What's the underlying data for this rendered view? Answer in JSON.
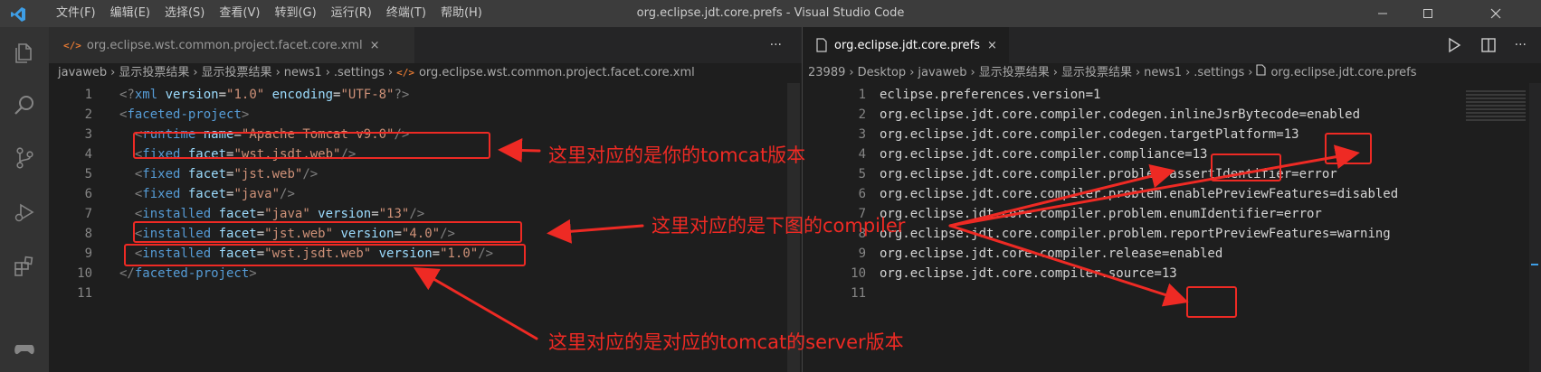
{
  "window": {
    "title": "org.eclipse.jdt.core.prefs - Visual Studio Code"
  },
  "menu": [
    "文件(F)",
    "编辑(E)",
    "选择(S)",
    "查看(V)",
    "转到(G)",
    "运行(R)",
    "终端(T)",
    "帮助(H)"
  ],
  "left_editor": {
    "tab_label": "org.eclipse.wst.common.project.facet.core.xml",
    "tab_icon": "xml-file-icon",
    "more_actions": "···",
    "breadcrumb": [
      "javaweb",
      "显示投票结果",
      "显示投票结果",
      "news1",
      ".settings",
      "org.eclipse.wst.common.project.facet.core.xml"
    ],
    "lines": [
      {
        "n": "1",
        "tokens": [
          {
            "t": "<?",
            "c": "punc"
          },
          {
            "t": "xml",
            "c": "tag"
          },
          {
            "t": " version",
            "c": "attr"
          },
          {
            "t": "=",
            "c": "plain"
          },
          {
            "t": "\"1.0\"",
            "c": "str"
          },
          {
            "t": " encoding",
            "c": "attr"
          },
          {
            "t": "=",
            "c": "plain"
          },
          {
            "t": "\"UTF-8\"",
            "c": "str"
          },
          {
            "t": "?>",
            "c": "punc"
          }
        ]
      },
      {
        "n": "2",
        "tokens": [
          {
            "t": "<",
            "c": "punc"
          },
          {
            "t": "faceted-project",
            "c": "tag"
          },
          {
            "t": ">",
            "c": "punc"
          }
        ]
      },
      {
        "n": "3",
        "tokens": [
          {
            "t": "  <",
            "c": "punc"
          },
          {
            "t": "runtime",
            "c": "tag"
          },
          {
            "t": " name",
            "c": "attr"
          },
          {
            "t": "=",
            "c": "plain"
          },
          {
            "t": "\"Apache Tomcat v9.0\"",
            "c": "str"
          },
          {
            "t": "/>",
            "c": "punc"
          }
        ]
      },
      {
        "n": "4",
        "tokens": [
          {
            "t": "  <",
            "c": "punc"
          },
          {
            "t": "fixed",
            "c": "tag"
          },
          {
            "t": " facet",
            "c": "attr"
          },
          {
            "t": "=",
            "c": "plain"
          },
          {
            "t": "\"wst.jsdt.web\"",
            "c": "str"
          },
          {
            "t": "/>",
            "c": "punc"
          }
        ]
      },
      {
        "n": "5",
        "tokens": [
          {
            "t": "  <",
            "c": "punc"
          },
          {
            "t": "fixed",
            "c": "tag"
          },
          {
            "t": " facet",
            "c": "attr"
          },
          {
            "t": "=",
            "c": "plain"
          },
          {
            "t": "\"jst.web\"",
            "c": "str"
          },
          {
            "t": "/>",
            "c": "punc"
          }
        ]
      },
      {
        "n": "6",
        "tokens": [
          {
            "t": "  <",
            "c": "punc"
          },
          {
            "t": "fixed",
            "c": "tag"
          },
          {
            "t": " facet",
            "c": "attr"
          },
          {
            "t": "=",
            "c": "plain"
          },
          {
            "t": "\"java\"",
            "c": "str"
          },
          {
            "t": "/>",
            "c": "punc"
          }
        ]
      },
      {
        "n": "7",
        "tokens": [
          {
            "t": "  <",
            "c": "punc"
          },
          {
            "t": "installed",
            "c": "tag"
          },
          {
            "t": " facet",
            "c": "attr"
          },
          {
            "t": "=",
            "c": "plain"
          },
          {
            "t": "\"java\"",
            "c": "str"
          },
          {
            "t": " version",
            "c": "attr"
          },
          {
            "t": "=",
            "c": "plain"
          },
          {
            "t": "\"13\"",
            "c": "str"
          },
          {
            "t": "/>",
            "c": "punc"
          }
        ]
      },
      {
        "n": "8",
        "tokens": [
          {
            "t": "  <",
            "c": "punc"
          },
          {
            "t": "installed",
            "c": "tag"
          },
          {
            "t": " facet",
            "c": "attr"
          },
          {
            "t": "=",
            "c": "plain"
          },
          {
            "t": "\"jst.web\"",
            "c": "str"
          },
          {
            "t": " version",
            "c": "attr"
          },
          {
            "t": "=",
            "c": "plain"
          },
          {
            "t": "\"4.0\"",
            "c": "str"
          },
          {
            "t": "/>",
            "c": "punc"
          }
        ]
      },
      {
        "n": "9",
        "tokens": [
          {
            "t": "  <",
            "c": "punc"
          },
          {
            "t": "installed",
            "c": "tag"
          },
          {
            "t": " facet",
            "c": "attr"
          },
          {
            "t": "=",
            "c": "plain"
          },
          {
            "t": "\"wst.jsdt.web\"",
            "c": "str"
          },
          {
            "t": " version",
            "c": "attr"
          },
          {
            "t": "=",
            "c": "plain"
          },
          {
            "t": "\"1.0\"",
            "c": "str"
          },
          {
            "t": "/>",
            "c": "punc"
          }
        ]
      },
      {
        "n": "10",
        "tokens": [
          {
            "t": "</",
            "c": "punc"
          },
          {
            "t": "faceted-project",
            "c": "tag"
          },
          {
            "t": ">",
            "c": "punc"
          }
        ]
      },
      {
        "n": "11",
        "tokens": []
      }
    ]
  },
  "right_editor": {
    "tab_label": "org.eclipse.jdt.core.prefs",
    "tab_close": "×",
    "breadcrumb": [
      "23989",
      "Desktop",
      "javaweb",
      "显示投票结果",
      "显示投票结果",
      "news1",
      ".settings",
      "org.eclipse.jdt.core.prefs"
    ],
    "lines": [
      {
        "n": "1",
        "text": "eclipse.preferences.version=1"
      },
      {
        "n": "2",
        "text": "org.eclipse.jdt.core.compiler.codegen.inlineJsrBytecode=enabled"
      },
      {
        "n": "3",
        "text": "org.eclipse.jdt.core.compiler.codegen.targetPlatform=13"
      },
      {
        "n": "4",
        "text": "org.eclipse.jdt.core.compiler.compliance=13"
      },
      {
        "n": "5",
        "text": "org.eclipse.jdt.core.compiler.problem.assertIdentifier=error"
      },
      {
        "n": "6",
        "text": "org.eclipse.jdt.core.compiler.problem.enablePreviewFeatures=disabled"
      },
      {
        "n": "7",
        "text": "org.eclipse.jdt.core.compiler.problem.enumIdentifier=error"
      },
      {
        "n": "8",
        "text": "org.eclipse.jdt.core.compiler.problem.reportPreviewFeatures=warning"
      },
      {
        "n": "9",
        "text": "org.eclipse.jdt.core.compiler.release=enabled"
      },
      {
        "n": "10",
        "text": "org.eclipse.jdt.core.compiler.source=13"
      },
      {
        "n": "11",
        "text": ""
      }
    ]
  },
  "annotations": {
    "note_tomcat": "这里对应的是你的tomcat版本",
    "note_compiler": "这里对应的是下图的compiler",
    "note_server": "这里对应的是对应的tomcat的server版本",
    "color": "#ee2a24"
  },
  "colors": {
    "tag": "#569cd6",
    "attribute": "#9cdcfe",
    "string": "#ce9178",
    "text": "#d4d4d4",
    "background": "#1e1e1e"
  }
}
